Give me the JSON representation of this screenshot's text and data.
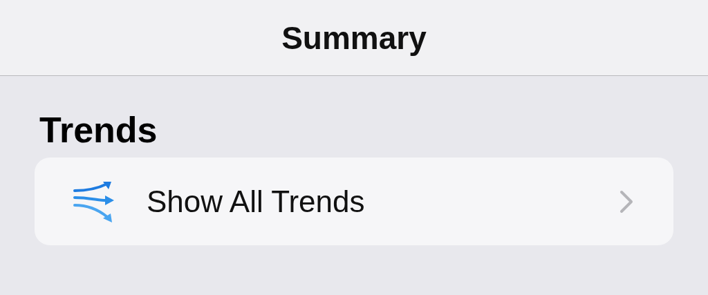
{
  "nav_bar": {
    "title": "Summary"
  },
  "section": {
    "title": "Trends",
    "rows": [
      {
        "label": "Show All Trends"
      }
    ]
  }
}
